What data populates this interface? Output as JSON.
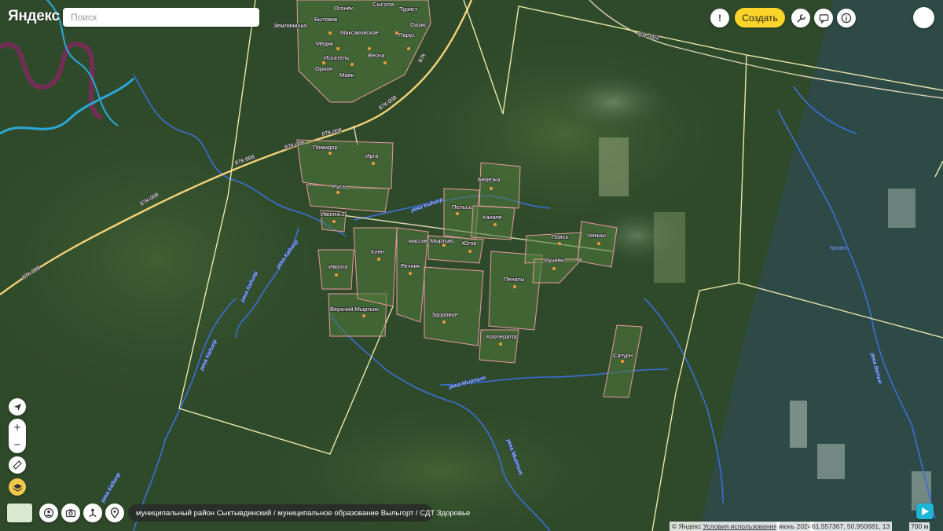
{
  "header": {
    "logo": "Яндекс",
    "search_placeholder": "Поиск",
    "create_label": "Создать",
    "report_label": "!"
  },
  "map_labels": {
    "places": [
      "Земляничка",
      "Огонёк",
      "Сысола",
      "Турист",
      "Бытовик",
      "Медик",
      "Максаковское",
      "Оазис",
      "Парус",
      "Искатель",
      "Весна",
      "Орион",
      "Маяк",
      "Помидор",
      "Ирга",
      "Русь",
      "Иволга 2",
      "Берёзка",
      "Пельсь",
      "Канапе",
      "массив Мыртыю",
      "Югор",
      "Клён",
      "Речник",
      "Иволга",
      "Поиск",
      "Чикыш",
      "Ручеёк",
      "Пенаты",
      "Верхний Мыртыю",
      "Здоровье",
      "Кооператор",
      "Сатурн"
    ],
    "roads": [
      "87К-008",
      "87К-008",
      "87К-008",
      "87К-008",
      "87К-008",
      "87К-008",
      "87Р-003",
      "87К"
    ],
    "rivers": [
      "река Кадшор",
      "река Кадшор",
      "река Кадшор",
      "река Кадшор",
      "река Кадшор",
      "река Мыртыю",
      "река Мыртыю",
      "река Ветью",
      "Yandex"
    ]
  },
  "breadcrumb": "муниципальный район Сыктывдинский / муниципальное образование Выльгорт / СДТ Здоровье",
  "footer": {
    "copyright": "© Яндекс",
    "terms": "Условия использования",
    "imagery_date": "июнь 2024",
    "coordinates": "61.557367, 50.950681, 13",
    "scale": "700 м"
  },
  "colors": {
    "forest": "#2f4a2a",
    "boundary": "#f3efb2",
    "plot_outline": "#e99aa3",
    "road": "#f3d27a",
    "river": "#3c6fd8",
    "accent": "#fbd429"
  },
  "icons": [
    "info-icon",
    "comments-icon",
    "tools-icon",
    "report-icon",
    "navigate-icon",
    "zoom-in-icon",
    "zoom-out-icon",
    "ruler-icon",
    "layers-icon",
    "panorama-icon",
    "camera-icon",
    "route-icon",
    "pin-icon",
    "navigator-icon"
  ]
}
